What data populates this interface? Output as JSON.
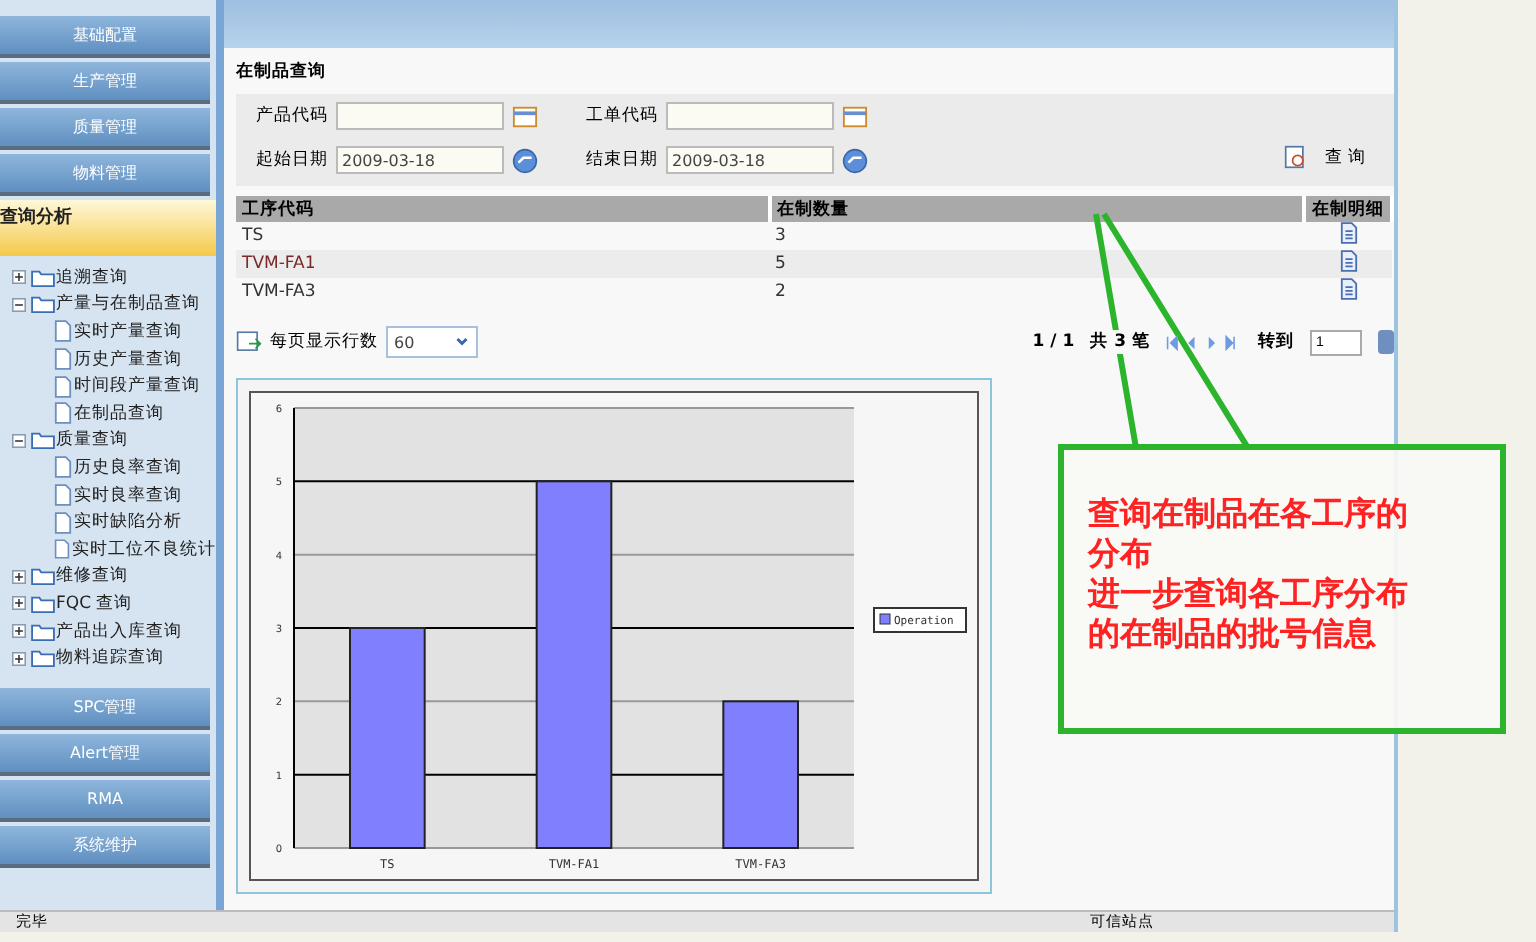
{
  "sidebar": {
    "top_menus": [
      {
        "label": "基础配置"
      },
      {
        "label": "生产管理"
      },
      {
        "label": "质量管理"
      },
      {
        "label": "物料管理"
      }
    ],
    "section": {
      "label": "查询分析",
      "selected": true
    },
    "tree": [
      {
        "label": "追溯查询",
        "expanded": false
      },
      {
        "label": "产量与在制品查询",
        "expanded": true,
        "children": [
          {
            "label": "实时产量查询"
          },
          {
            "label": "历史产量查询"
          },
          {
            "label": "时间段产量查询"
          },
          {
            "label": "在制品查询"
          }
        ]
      },
      {
        "label": "质量查询",
        "expanded": true,
        "children": [
          {
            "label": "历史良率查询"
          },
          {
            "label": "实时良率查询"
          },
          {
            "label": "实时缺陷分析"
          },
          {
            "label": "实时工位不良统计"
          }
        ]
      },
      {
        "label": "维修查询",
        "expanded": false
      },
      {
        "label": "FQC 查询",
        "expanded": false
      },
      {
        "label": "产品出入库查询",
        "expanded": false
      },
      {
        "label": "物料追踪查询",
        "expanded": false
      }
    ],
    "bottom_menus": [
      {
        "label": "SPC管理"
      },
      {
        "label": "Alert管理"
      },
      {
        "label": "RMA"
      },
      {
        "label": "系统维护"
      }
    ]
  },
  "page": {
    "title": "在制品查询",
    "filters": [
      {
        "label": "产品代码",
        "kind": "lookup"
      },
      {
        "label": "工单代码",
        "kind": "lookup"
      },
      {
        "label": "起始日期",
        "value": "2009-03-18",
        "kind": "date"
      },
      {
        "label": "结束日期",
        "value": "2009-03-18",
        "kind": "date"
      }
    ],
    "query_button": "查 询",
    "table": {
      "columns": [
        "工序代码",
        "在制数量",
        "在制明细"
      ],
      "rows": [
        {
          "code": "TS",
          "qty": "3"
        },
        {
          "code": "TVM-FA1",
          "qty": "5"
        },
        {
          "code": "TVM-FA3",
          "qty": "2"
        }
      ]
    },
    "page_size_label": "每页显示行数",
    "page_size": "60",
    "pager": {
      "position": "1 / 1",
      "total": "共 3 笔",
      "goto_label": "转到",
      "goto_value": "1"
    },
    "chart_data": {
      "type": "bar",
      "grid": true,
      "categories": [
        "TS",
        "TVM-FA1",
        "TVM-FA3"
      ],
      "ylim": [
        0,
        6
      ],
      "yticks": [
        0,
        1,
        2,
        3,
        4,
        5,
        6
      ],
      "series": [
        {
          "name": "Operation",
          "color": "#8080ff",
          "values": [
            3,
            5,
            2
          ]
        }
      ]
    }
  },
  "callout": {
    "lines": [
      "查询在制品在各工序的",
      "分布",
      "进一步查询各工序分布",
      "的在制品的批号信息"
    ]
  },
  "status_bar": {
    "text": "完毕",
    "zone": "可信站点"
  }
}
